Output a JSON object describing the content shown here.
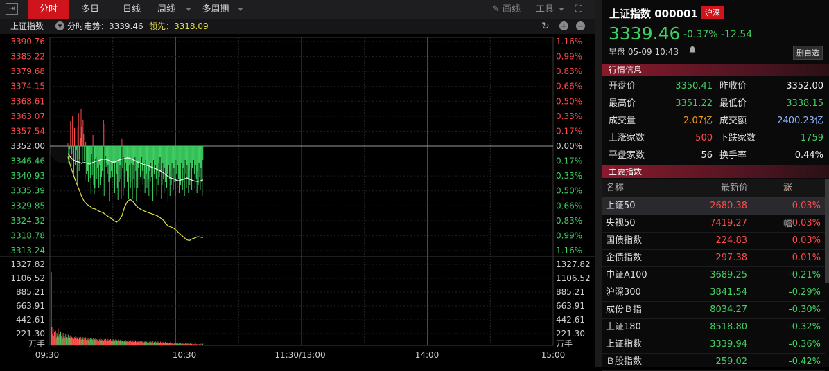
{
  "toolbar": {
    "tabs": [
      "分时",
      "多日",
      "日线",
      "周线",
      "多周期"
    ],
    "active_tab": "分时",
    "draw_label": "画线",
    "tools_label": "工具"
  },
  "infobar": {
    "name": "上证指数",
    "trend_label": "分时走势：3339.46",
    "leading_label": "领先：3318.09"
  },
  "chart_data": {
    "type": "line",
    "prev_close": 3352.0,
    "price_axis_left": [
      "3390.76",
      "3385.22",
      "3379.68",
      "3374.15",
      "3368.61",
      "3363.07",
      "3357.54",
      "3352.00",
      "3346.46",
      "3340.93",
      "3335.39",
      "3329.85",
      "3324.32",
      "3318.78",
      "3313.24"
    ],
    "pct_axis_right": [
      "1.16%",
      "0.99%",
      "0.83%",
      "0.66%",
      "0.50%",
      "0.33%",
      "0.17%",
      "0.00%",
      "0.17%",
      "0.33%",
      "0.50%",
      "0.66%",
      "0.83%",
      "0.99%",
      "1.16%"
    ],
    "volume_axis": [
      "1327.82",
      "1106.52",
      "885.21",
      "663.91",
      "442.61",
      "221.30"
    ],
    "volume_unit": "万手",
    "x_labels": [
      "09:30",
      "10:30",
      "11:30/13:00",
      "14:00",
      "15:00"
    ],
    "series": [
      {
        "name": "分时走势",
        "color": "#ffffff",
        "values": [
          3349.2,
          3347.8,
          3346.9,
          3346.3,
          3346.1,
          3345.6,
          3345.9,
          3345.7,
          3345.3,
          3345.8,
          3346.3,
          3346.5,
          3346.9,
          3347.2,
          3347.1,
          3346.8,
          3346.2,
          3346.0,
          3346.4,
          3346.9,
          3347.2,
          3347.4,
          3347.7,
          3347.5,
          3347.0,
          3346.5,
          3346.0,
          3345.6,
          3345.2,
          3344.9,
          3344.6,
          3344.2,
          3343.8,
          3343.4,
          3342.9,
          3342.3,
          3341.5,
          3340.8,
          3340.2,
          3339.9,
          3339.4,
          3339.1,
          3339.5,
          3339.8,
          3340.2,
          3339.7,
          3339.3,
          3339.0,
          3338.9,
          3339.1,
          3339.46
        ]
      },
      {
        "name": "领先",
        "color": "#e6e24a",
        "values": [
          3348.0,
          3344.5,
          3341.5,
          3338.6,
          3336.2,
          3333.5,
          3331.5,
          3330.4,
          3329.8,
          3328.9,
          3328.7,
          3328.1,
          3327.6,
          3327.3,
          3326.5,
          3325.8,
          3325.2,
          3324.3,
          3323.8,
          3324.6,
          3326.2,
          3329.5,
          3331.4,
          3332.2,
          3331.5,
          3330.2,
          3329.1,
          3328.5,
          3328.0,
          3327.6,
          3327.2,
          3326.9,
          3326.5,
          3326.2,
          3325.5,
          3324.8,
          3323.5,
          3322.4,
          3322.0,
          3321.6,
          3320.8,
          3319.8,
          3318.9,
          3318.0,
          3317.2,
          3317.0,
          3317.6,
          3317.9,
          3318.4,
          3318.2,
          3318.09
        ]
      }
    ],
    "diff_bars": [
      2,
      -12,
      -10,
      -2,
      18,
      -15,
      -6,
      22,
      -4,
      -20,
      13,
      -14,
      11,
      -3,
      -28,
      14,
      24,
      -18,
      -9,
      6,
      27,
      14,
      -12,
      19,
      9,
      -11,
      -25,
      3,
      -20,
      -33,
      -18,
      -26,
      -9,
      -12,
      -23,
      -35,
      -6,
      -21,
      8,
      -28,
      -35,
      -30,
      -9,
      -8,
      -24,
      -16,
      -22,
      -30,
      -14,
      -28,
      -35,
      -22,
      -18,
      -9,
      19,
      -36,
      16,
      -7,
      -15,
      -12,
      -20,
      -14,
      -26,
      -40,
      -10,
      -23,
      -18,
      -30,
      -22,
      -12,
      -28,
      -34,
      -12,
      -26,
      -20,
      -30,
      -39,
      -12,
      -26,
      -14,
      -24,
      -38,
      5,
      -16,
      -36,
      -8,
      -30,
      -22,
      -12,
      -18,
      -26,
      -16,
      -38,
      -14,
      -22,
      -30,
      -12,
      -26,
      -38,
      -14,
      -24,
      -30,
      -8,
      -18,
      -40,
      -22,
      -30,
      -16,
      -28,
      -12,
      -22,
      -34,
      -8,
      -18,
      -28,
      -12,
      -24,
      -34,
      -10,
      -20,
      -30,
      -14,
      -24,
      -36,
      -18,
      -26,
      -12,
      -22,
      -34,
      -40,
      -10,
      -20,
      -30,
      -14,
      -24,
      -36,
      -18,
      -28,
      -12,
      -22,
      -8,
      -18,
      -38,
      -28,
      -12,
      -24,
      -34,
      -16,
      -26,
      -10,
      -30,
      -20,
      -40,
      -14,
      -24,
      -36,
      -18,
      -28,
      -12,
      -22,
      -32,
      -16,
      -26,
      -36,
      -10,
      -20,
      -30,
      -14,
      -24,
      -34,
      -18,
      -28,
      -12,
      -22,
      -32,
      -16,
      -26,
      -36,
      -10,
      -20,
      -30,
      -14,
      -24,
      -34,
      -18,
      -28,
      -12,
      -22,
      -32,
      -16,
      -26,
      -10,
      -20,
      -30,
      -14,
      -24,
      -34,
      -18,
      -28,
      -12,
      -22,
      -32,
      -16,
      -26,
      -36,
      -10,
      -20,
      -30,
      -40,
      -14,
      -24,
      -34,
      -18,
      -28,
      -12,
      -22,
      -32,
      -16,
      -26,
      -36,
      -10,
      -20,
      -30,
      -14,
      -24,
      -34,
      -18,
      -28,
      -12,
      -22
    ],
    "volume": [
      1200,
      300,
      180,
      260,
      150,
      220,
      170,
      240,
      130,
      200,
      160,
      280,
      140,
      190,
      120,
      230,
      150,
      175,
      110,
      205,
      140,
      160,
      125,
      190,
      135,
      150,
      115,
      175,
      130,
      145,
      120,
      165,
      110,
      140,
      125,
      155,
      105,
      135,
      118,
      148,
      100,
      132,
      112,
      142,
      98,
      128,
      108,
      138,
      95,
      122,
      104,
      134,
      92,
      118,
      100,
      130,
      90,
      115,
      98,
      126,
      88,
      110,
      96,
      122,
      86,
      108,
      94,
      118,
      84,
      104,
      92,
      114,
      82,
      102,
      90,
      112,
      80,
      100,
      88,
      110,
      78,
      98,
      86,
      108,
      76,
      96,
      84,
      106,
      75,
      94,
      82,
      104,
      74,
      92,
      80,
      102,
      72,
      90,
      78,
      100,
      70,
      88,
      76,
      98,
      68,
      86,
      74,
      96,
      66,
      84,
      72,
      94,
      64,
      82,
      70,
      92,
      62,
      80,
      68,
      90,
      60,
      78,
      66,
      88,
      58,
      76,
      64,
      86,
      56,
      74,
      62,
      84,
      55,
      72,
      60,
      82,
      54,
      70,
      58,
      80,
      52,
      68,
      56,
      78,
      50,
      66,
      54,
      76,
      48,
      64,
      52,
      74,
      46,
      62,
      50,
      72,
      44,
      60,
      48,
      70,
      42,
      58,
      46,
      68,
      40,
      56,
      44,
      66,
      38,
      54,
      42,
      64,
      36,
      52,
      40,
      62,
      34,
      50,
      38,
      60,
      32,
      48,
      36,
      58,
      30,
      46,
      34,
      56,
      30,
      44,
      32,
      54,
      28,
      42,
      30,
      52,
      26,
      40,
      28,
      50,
      25,
      38,
      26,
      48,
      24,
      36,
      25,
      46,
      22,
      34,
      24,
      44,
      21,
      32,
      22,
      42,
      20,
      30,
      21,
      40,
      18,
      28,
      20,
      38,
      17,
      26,
      18,
      36,
      16,
      24,
      17,
      34,
      15,
      22,
      16,
      32,
      14,
      20,
      15,
      30,
      13,
      18,
      14,
      28,
      12,
      16,
      13,
      26
    ]
  },
  "right": {
    "title": "上证指数 000001",
    "badge": "沪深",
    "price": "3339.46",
    "pct": "-0.37%",
    "change": "-12.54",
    "meta": "早盘  05-09  10:43",
    "self_btn": "删自选",
    "sec_quote": "行情信息",
    "quote_rows": [
      {
        "l1": "开盘价",
        "v1": "3350.41",
        "c1": "green",
        "l2": "昨收价",
        "v2": "3352.00",
        "c2": "white"
      },
      {
        "l1": "最高价",
        "v1": "3351.22",
        "c1": "green",
        "l2": "最低价",
        "v2": "3338.15",
        "c2": "green"
      },
      {
        "l1": "成交量",
        "v1": "2.07亿",
        "c1": "orange",
        "l2": "成交额",
        "v2": "2400.23亿",
        "c2": "blue"
      },
      {
        "l1": "上涨家数",
        "v1": "500",
        "c1": "red",
        "l2": "下跌家数",
        "v2": "1759",
        "c2": "green"
      },
      {
        "l1": "平盘家数",
        "v1": "56",
        "c1": "white",
        "l2": "换手率",
        "v2": "0.44%",
        "c2": "white"
      }
    ],
    "sec_index": "主要指数",
    "idx_cols": [
      "名称",
      "最新价",
      "涨跌幅"
    ],
    "idx_rows": [
      {
        "name": "上证50",
        "price": "2680.38",
        "pct": "0.03%",
        "color": "red"
      },
      {
        "name": "央视50",
        "price": "7419.27",
        "pct": "0.03%",
        "color": "red"
      },
      {
        "name": "国债指数",
        "price": "224.83",
        "pct": "0.03%",
        "color": "red"
      },
      {
        "name": "企债指数",
        "price": "297.38",
        "pct": "0.01%",
        "color": "red"
      },
      {
        "name": "中证A100",
        "price": "3689.25",
        "pct": "-0.21%",
        "color": "green"
      },
      {
        "name": "沪深300",
        "price": "3841.54",
        "pct": "-0.29%",
        "color": "green"
      },
      {
        "name": "成份Ｂ指",
        "price": "8034.27",
        "pct": "-0.30%",
        "color": "green"
      },
      {
        "name": "上证180",
        "price": "8518.80",
        "pct": "-0.32%",
        "color": "green"
      },
      {
        "name": "上证指数",
        "price": "3339.94",
        "pct": "-0.36%",
        "color": "green"
      },
      {
        "name": "Ｂ股指数",
        "price": "259.02",
        "pct": "-0.42%",
        "color": "green"
      }
    ]
  }
}
